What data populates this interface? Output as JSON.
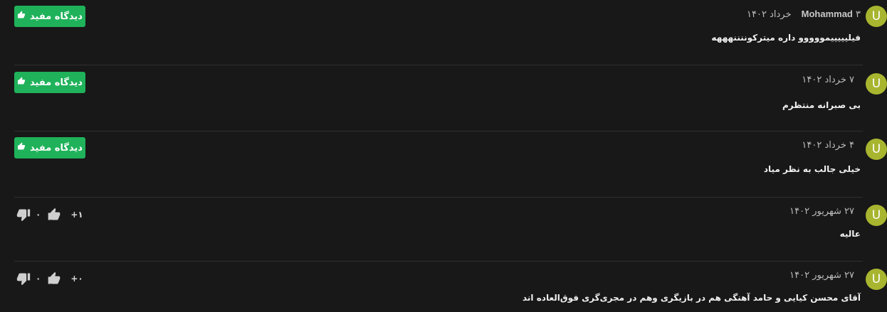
{
  "helpful_label": "دیدگاه مفید",
  "comments": [
    {
      "avatar_letter": "U",
      "author": "Mohammad",
      "date": "۳ خرداد ۱۴۰۲",
      "text": "فیلیییییمووووو داره میترکوننننهههه"
    },
    {
      "avatar_letter": "U",
      "author": "",
      "date": "۷ خرداد ۱۴۰۲",
      "text": "بی صبرانه منتظرم"
    },
    {
      "avatar_letter": "U",
      "author": "",
      "date": "۴ خرداد ۱۴۰۲",
      "text": "خیلی جالب به نظر میاد"
    },
    {
      "avatar_letter": "U",
      "author": "",
      "date": "۲۷ شهریور ۱۴۰۲",
      "text": "عالیه",
      "votes": {
        "score": "+۱",
        "likes": "۰"
      }
    },
    {
      "avatar_letter": "U",
      "author": "",
      "date": "۲۷ شهریور ۱۴۰۲",
      "text": "آقای محسن کیایی و حامد آهنگی هم در بازیگری وهم در مجری‌گری فوق‌العاده اند",
      "votes": {
        "score": "+۰",
        "likes": "۰"
      }
    }
  ]
}
